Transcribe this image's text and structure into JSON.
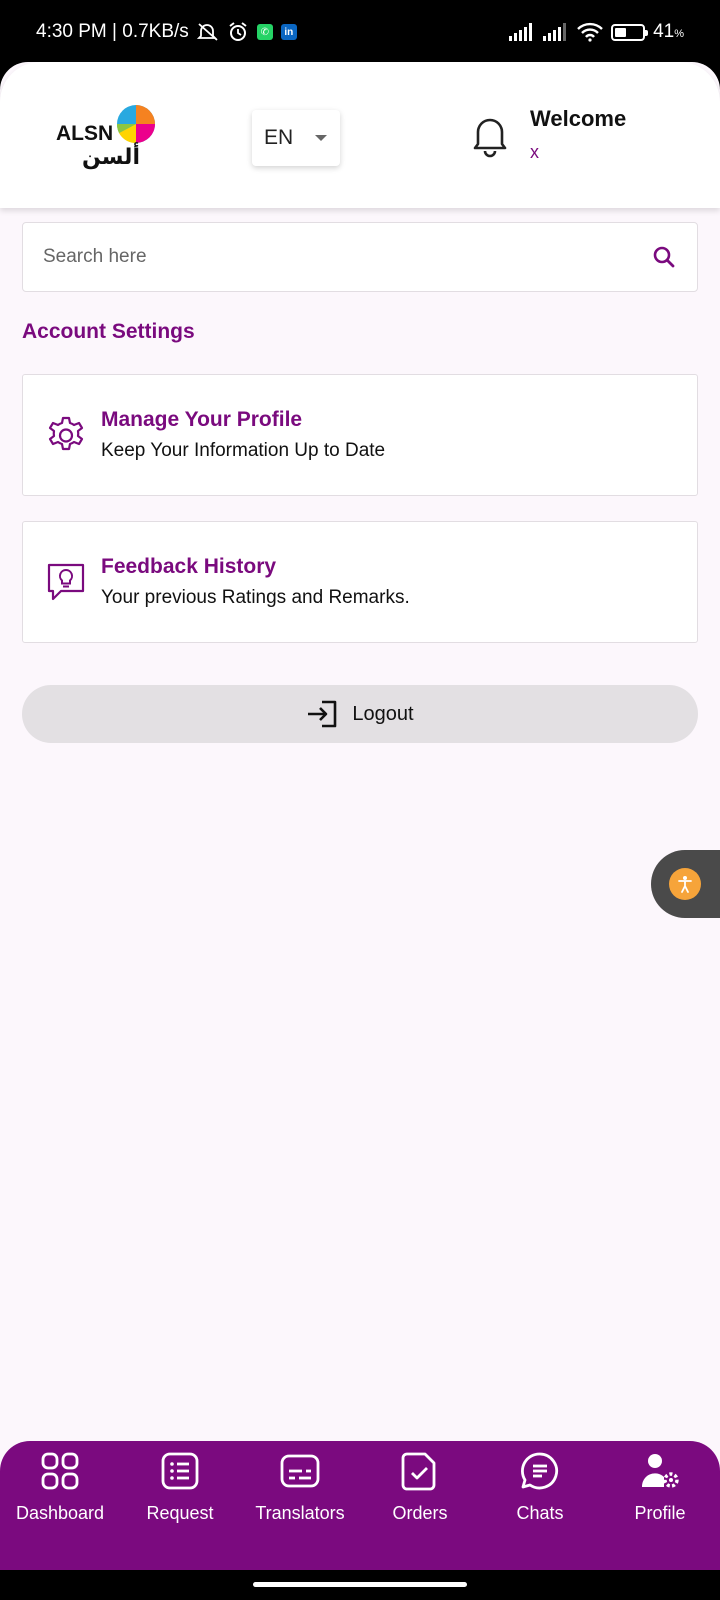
{
  "status_bar": {
    "time_speed": "4:30 PM | 0.7KB/s",
    "battery": "41",
    "battery_unit": "%",
    "battery_level_percent": 41,
    "icons": [
      "mute-icon",
      "alarm-icon",
      "whatsapp-icon",
      "linkedin-icon",
      "signal-icon",
      "signal-icon",
      "wifi-icon",
      "battery-icon"
    ]
  },
  "header": {
    "logo_text_latin": "ALSN",
    "logo_text_arabic": "ألسن",
    "language": "EN",
    "welcome_title": "Welcome",
    "welcome_name": "x"
  },
  "search": {
    "placeholder": "Search here",
    "value": ""
  },
  "account_settings": {
    "title": "Account Settings",
    "items": [
      {
        "icon": "gear-icon",
        "title": "Manage Your Profile",
        "subtitle": "Keep Your Information Up to Date"
      },
      {
        "icon": "feedback-icon",
        "title": "Feedback History",
        "subtitle": "Your previous Ratings and Remarks."
      }
    ]
  },
  "logout": {
    "label": "Logout",
    "icon": "logout-icon"
  },
  "bottom_nav": {
    "items": [
      {
        "label": "Dashboard",
        "icon": "grid-icon"
      },
      {
        "label": "Request",
        "icon": "list-icon"
      },
      {
        "label": "Translators",
        "icon": "subtitles-icon"
      },
      {
        "label": "Orders",
        "icon": "document-check-icon"
      },
      {
        "label": "Chats",
        "icon": "chat-icon"
      },
      {
        "label": "Profile",
        "icon": "user-settings-icon"
      }
    ],
    "active": "Profile"
  },
  "colors": {
    "primary": "#7b0a7f",
    "background": "#fcf7fc",
    "accessibility": "#f6a43a"
  }
}
